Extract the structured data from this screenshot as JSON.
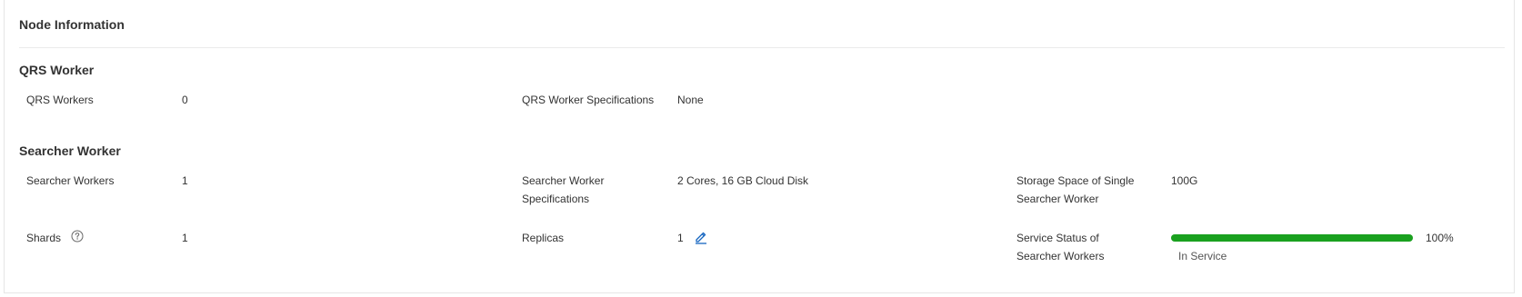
{
  "card": {
    "title": "Node Information"
  },
  "qrs": {
    "section_title": "QRS Worker",
    "workers_label": "QRS Workers",
    "workers_value": "0",
    "spec_label": "QRS Worker Specifications",
    "spec_value": "None"
  },
  "searcher": {
    "section_title": "Searcher Worker",
    "workers_label": "Searcher Workers",
    "workers_value": "1",
    "spec_label": "Searcher Worker Specifications",
    "spec_value": "2 Cores, 16 GB Cloud Disk",
    "storage_label": "Storage Space of Single Searcher Worker",
    "storage_value": "100G",
    "shards_label": "Shards",
    "shards_value": "1",
    "replicas_label": "Replicas",
    "replicas_value": "1",
    "status_label": "Service Status of Searcher Workers",
    "status_progress_percent": 100,
    "status_progress_text": "100%",
    "status_text": "In Service"
  },
  "colors": {
    "progress": "#1aa11f",
    "link": "#1565c0"
  },
  "icons": {
    "help": "question-circle-icon",
    "edit": "pencil-edit-icon"
  }
}
